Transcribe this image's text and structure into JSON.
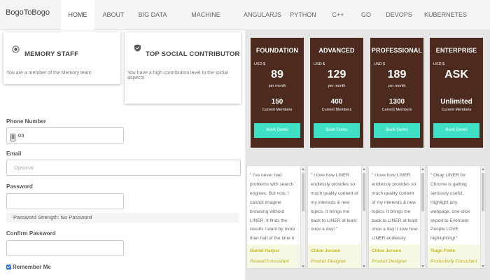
{
  "brand": "BogoToBogo",
  "nav": {
    "items": [
      "HOME",
      "ABOUT",
      "BIG DATA",
      "MACHINE LEARNING",
      "ANGULARJS",
      "PYTHON",
      "C++",
      "GO",
      "DEVOPS",
      "KUBERNETES"
    ],
    "active": "HOME"
  },
  "achievements": [
    {
      "icon": "medal-icon",
      "title": "MEMORY STAFF",
      "desc": "You are a member of the Memory team"
    },
    {
      "icon": "shield-check-icon",
      "title": "TOP SOCIAL CONTRIBUTOR",
      "desc": "You have a high contribution level to the social aspects"
    }
  ],
  "form": {
    "phone": {
      "label": "Phone Number",
      "value": "03",
      "icon": "phone-icon"
    },
    "email": {
      "label": "Email",
      "placeholder": "Optional"
    },
    "password": {
      "label": "Password",
      "value": ""
    },
    "strength": "Password Strength: No Password",
    "confirm": {
      "label": "Confirm Password",
      "value": ""
    },
    "remember": {
      "label": "Remember Me",
      "checked": true
    }
  },
  "plans": [
    {
      "name": "FOUNDATION",
      "currency": "USD $",
      "price": "89",
      "per": "per month",
      "members": "150",
      "members_label": "Current Members",
      "button": "Book Demo"
    },
    {
      "name": "ADVANCED",
      "currency": "USD $",
      "price": "129",
      "per": "per month",
      "members": "400",
      "members_label": "Current Members",
      "button": "Book Demo"
    },
    {
      "name": "PROFESSIONAL",
      "currency": "USD $",
      "price": "189",
      "per": "per month",
      "members": "1300",
      "members_label": "Current Members",
      "button": "Book Demo"
    },
    {
      "name": "ENTERPRISE",
      "currency": "USD $",
      "price": "ASK",
      "per": "",
      "members": "Unlimited",
      "members_label": "Current Members",
      "button": "Book Demo"
    }
  ],
  "testimonials": [
    {
      "quote": "\" I've never had problems with search engines. But now, I cannot imagine browsing without LINER. It finds the results I want by more than half of the time it used to take. \"",
      "name": "Daniel Harper",
      "role": "Research Assistant"
    },
    {
      "quote": "\" I love how LINER endlessly provides so much quality content of my interests & new topics. It brings me back to LINER at least once a day! \"",
      "name": "Chloe Jensen",
      "role": "Product Designer"
    },
    {
      "quote": "\" I love how LINER endlessly provides so much quality content of my interests & new topics. It brings me back to LINER at least once a day! I love how LINER endlessly provides so much quality content of my",
      "name": "Chloe Jensen",
      "role": "Product Designer"
    },
    {
      "quote": "\" Okay LINER for Chrome is getting seriously useful. Highlight any webpage, one-click export to Evernote. People LOVE highlighting! \"",
      "name": "Tiago Forte",
      "role": "Productivity Consultant"
    }
  ],
  "colors": {
    "plan_bg": "#4c2a1e",
    "plan_button": "#3fe0c5",
    "panel_bg": "#e6e6e6",
    "testimonial_name": "#c2bb1a"
  }
}
